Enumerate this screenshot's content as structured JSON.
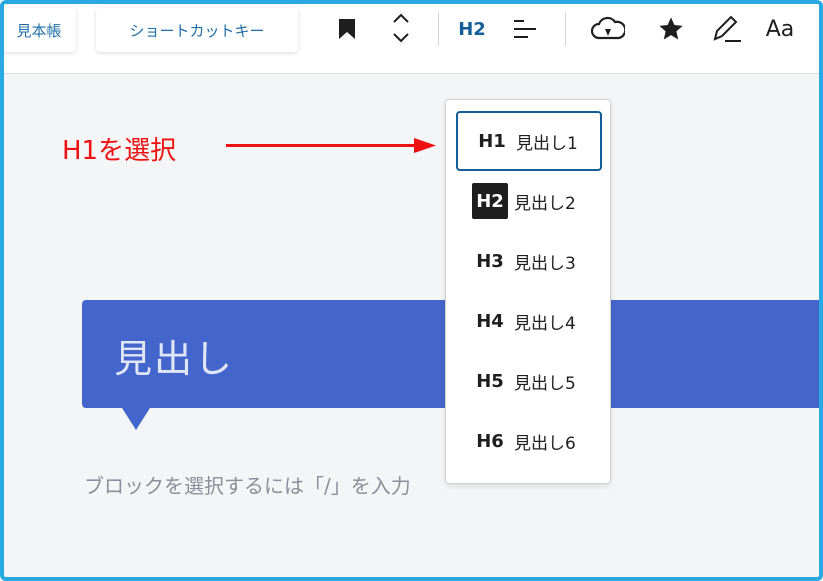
{
  "toolbar": {
    "mihoncho_label": "見本帳",
    "shortcut_label": "ショートカットキー",
    "current_heading_label": "H2",
    "font_label": "Aa"
  },
  "annotation": {
    "text": "H1を選択",
    "color": "#ee1111"
  },
  "heading_block": {
    "text": "見出し",
    "color": "#4466cc"
  },
  "editor": {
    "placeholder": "ブロックを選択するには「/」を入力"
  },
  "heading_menu": {
    "items": [
      {
        "code": "H1",
        "label": "見出し1",
        "focused": true
      },
      {
        "code": "H2",
        "label": "見出し2",
        "selected": true
      },
      {
        "code": "H3",
        "label": "見出し3"
      },
      {
        "code": "H4",
        "label": "見出し4"
      },
      {
        "code": "H5",
        "label": "見出し5"
      },
      {
        "code": "H6",
        "label": "見出し6"
      }
    ]
  },
  "icons": [
    "bookmark-icon",
    "move-up-icon",
    "move-down-icon",
    "align-icon",
    "cloud-icon",
    "star-icon",
    "pen-icon"
  ],
  "colors": {
    "frame_border": "#29a9e1",
    "accent": "#135e96"
  }
}
